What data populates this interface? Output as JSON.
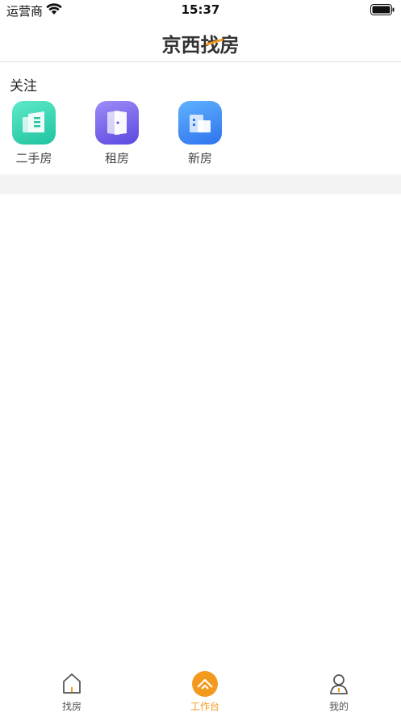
{
  "status_bar": {
    "carrier": "运营商",
    "time": "15:37"
  },
  "header": {
    "title": "京西找房",
    "accent_color": "#f39a1e"
  },
  "follow_section": {
    "title": "关注",
    "items": [
      {
        "label": "二手房",
        "icon": "building-icon",
        "color": "#2fd1ad"
      },
      {
        "label": "租房",
        "icon": "door-icon",
        "color": "#6e5ce8"
      },
      {
        "label": "新房",
        "icon": "office-building-icon",
        "color": "#3c86f3"
      }
    ]
  },
  "tab_bar": {
    "active_index": 1,
    "active_color": "#f39a1e",
    "tabs": [
      {
        "label": "找房",
        "icon": "house-icon"
      },
      {
        "label": "工作台",
        "icon": "workbench-icon"
      },
      {
        "label": "我的",
        "icon": "user-icon"
      }
    ]
  }
}
